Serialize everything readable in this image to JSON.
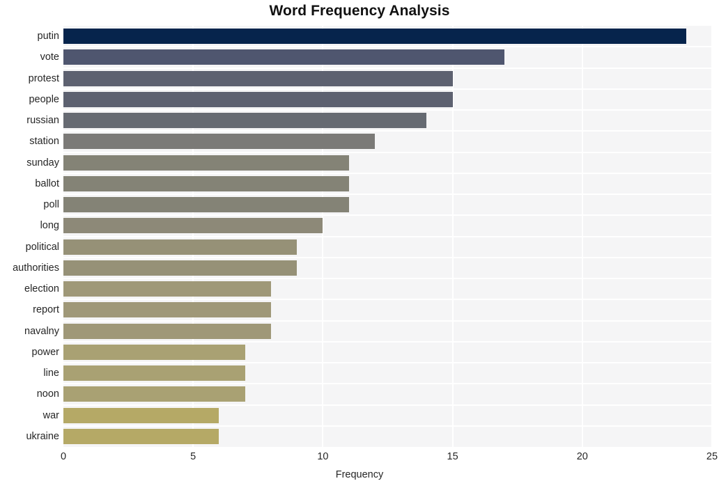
{
  "chart_data": {
    "type": "bar",
    "orientation": "horizontal",
    "title": "Word Frequency Analysis",
    "xlabel": "Frequency",
    "ylabel": "",
    "xlim": [
      0,
      25
    ],
    "xticks": [
      0,
      5,
      10,
      15,
      20,
      25
    ],
    "xtick_labels": [
      "0",
      "5",
      "10",
      "15",
      "20",
      "25"
    ],
    "grid": true,
    "legend": "none",
    "categories": [
      "putin",
      "vote",
      "protest",
      "people",
      "russian",
      "station",
      "sunday",
      "ballot",
      "poll",
      "long",
      "political",
      "authorities",
      "election",
      "report",
      "navalny",
      "power",
      "line",
      "noon",
      "war",
      "ukraine"
    ],
    "values": [
      24,
      17,
      15,
      15,
      14,
      12,
      11,
      11,
      11,
      10,
      9,
      9,
      8,
      8,
      8,
      7,
      7,
      7,
      6,
      6
    ],
    "bar_colors": [
      "#06244c",
      "#4f566f",
      "#5d6170",
      "#5d6170",
      "#666a72",
      "#7b7a77",
      "#848376",
      "#848376",
      "#848376",
      "#8d8978",
      "#969177",
      "#969177",
      "#9f9878",
      "#9f9878",
      "#9f9878",
      "#a9a173",
      "#a9a173",
      "#a9a173",
      "#b5a966",
      "#b5a966"
    ],
    "colors": {
      "plot_background": "#f5f5f6",
      "figure_background": "#ffffff",
      "gridline": "#ffffff",
      "title_text": "#111111",
      "tick_text": "#262626"
    }
  }
}
